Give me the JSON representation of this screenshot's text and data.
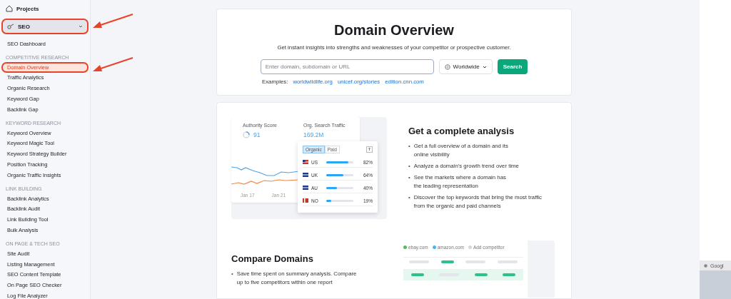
{
  "sidebar": {
    "projects": "Projects",
    "section": {
      "label": "SEO",
      "expanded": true,
      "circled": true
    },
    "items": [
      {
        "kind": "item",
        "label": "SEO Dashboard",
        "selected": false,
        "circled": false
      },
      {
        "kind": "header",
        "label": "COMPETITIVE RESEARCH"
      },
      {
        "kind": "item",
        "label": "Domain Overview",
        "selected": true,
        "circled": true
      },
      {
        "kind": "item",
        "label": "Traffic Analytics",
        "selected": false,
        "circled": false
      },
      {
        "kind": "item",
        "label": "Organic Research",
        "selected": false,
        "circled": false
      },
      {
        "kind": "item",
        "label": "Keyword Gap",
        "selected": false,
        "circled": false
      },
      {
        "kind": "item",
        "label": "Backlink Gap",
        "selected": false,
        "circled": false
      },
      {
        "kind": "header",
        "label": "KEYWORD RESEARCH"
      },
      {
        "kind": "item",
        "label": "Keyword Overview",
        "selected": false,
        "circled": false
      },
      {
        "kind": "item",
        "label": "Keyword Magic Tool",
        "selected": false,
        "circled": false
      },
      {
        "kind": "item",
        "label": "Keyword Strategy Builder",
        "selected": false,
        "circled": false
      },
      {
        "kind": "item",
        "label": "Position Tracking",
        "selected": false,
        "circled": false
      },
      {
        "kind": "item",
        "label": "Organic Traffic Insights",
        "selected": false,
        "circled": false
      },
      {
        "kind": "header",
        "label": "LINK BUILDING"
      },
      {
        "kind": "item",
        "label": "Backlink Analytics",
        "selected": false,
        "circled": false
      },
      {
        "kind": "item",
        "label": "Backlink Audit",
        "selected": false,
        "circled": false
      },
      {
        "kind": "item",
        "label": "Link Building Tool",
        "selected": false,
        "circled": false
      },
      {
        "kind": "item",
        "label": "Bulk Analysis",
        "selected": false,
        "circled": false
      },
      {
        "kind": "header",
        "label": "ON PAGE & TECH SEO"
      },
      {
        "kind": "item",
        "label": "Site Audit",
        "selected": false,
        "circled": false
      },
      {
        "kind": "item",
        "label": "Listing Management",
        "selected": false,
        "circled": false
      },
      {
        "kind": "item",
        "label": "SEO Content Template",
        "selected": false,
        "circled": false
      },
      {
        "kind": "item",
        "label": "On Page SEO Checker",
        "selected": false,
        "circled": false
      },
      {
        "kind": "item",
        "label": "Log File Analyzer",
        "selected": false,
        "circled": false
      }
    ]
  },
  "hero": {
    "title": "Domain Overview",
    "subtitle": "Get instant insights into strengths and weaknesses of your competitor or prospective customer.",
    "search": {
      "placeholder": "Enter domain, subdomain or URL"
    },
    "region": "Worldwide",
    "button": "Search",
    "examples_label": "Examples:",
    "examples": [
      "worldwildlife.org",
      "unicef.org/stories",
      "edition.cnn.com"
    ]
  },
  "analysis": {
    "preview": {
      "authority_label": "Authority Score",
      "authority_value": "91",
      "traffic_label": "Org. Search Traffic",
      "traffic_value": "169.2M",
      "dates": [
        "Jan 17",
        "Jan 21"
      ],
      "tabs": [
        {
          "label": "Organic",
          "selected": true
        },
        {
          "label": "Paid",
          "selected": false
        }
      ],
      "countries": [
        {
          "code": "US",
          "level": 0.82,
          "reading": "82%"
        },
        {
          "code": "UK",
          "level": 0.64,
          "reading": "64%"
        },
        {
          "code": "AU",
          "level": 0.4,
          "reading": "40%"
        },
        {
          "code": "NO",
          "level": 0.19,
          "reading": "19%"
        }
      ]
    },
    "title": "Get a complete analysis",
    "marker": "•",
    "bullets": [
      "Get a full overview of a domain and its\nonline visibility",
      "Analyze a domain’s growth trend over time",
      "See the markets where a domain has\nthe leading representation",
      "Discover the top keywords that bring the most traffic\nfrom the organic and paid channels"
    ]
  },
  "compare": {
    "title": "Compare Domains",
    "marker": "•",
    "bullets": [
      "Save time spent on summary analysis. Compare\nup to five competitors within one report"
    ],
    "legend": [
      {
        "label": "ebay.com",
        "color": "#5cb85c"
      },
      {
        "label": "amazon.com",
        "color": "#4db5f0"
      },
      {
        "label": "Add competitor",
        "color": "#d6d8dc"
      }
    ]
  },
  "thumbnail": {
    "text": "Googl"
  }
}
